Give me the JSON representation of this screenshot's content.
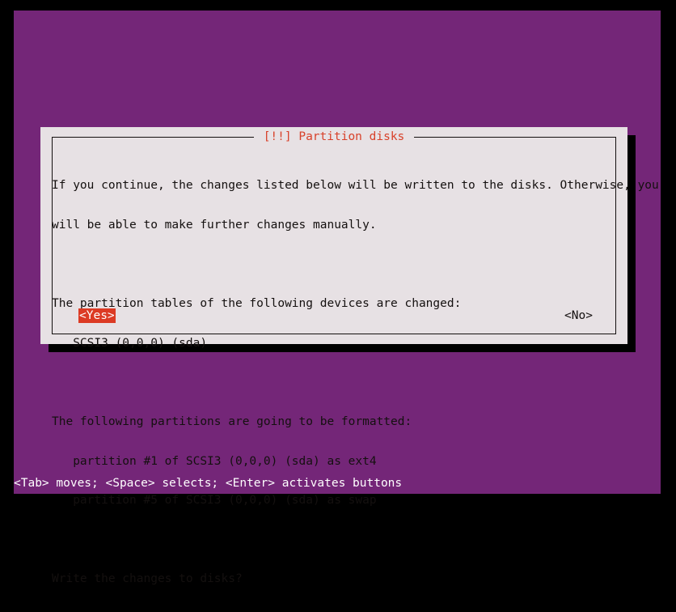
{
  "screen": {
    "background_color": "#000000",
    "console_color": "#742678"
  },
  "dialog": {
    "title": "[!!] Partition disks",
    "title_color": "#d8412a",
    "background_color": "#e7e1e4",
    "text_color": "#14100f",
    "body_lines": [
      "If you continue, the changes listed below will be written to the disks. Otherwise, you",
      "will be able to make further changes manually.",
      "",
      "The partition tables of the following devices are changed:",
      "   SCSI3 (0,0,0) (sda)",
      "",
      "The following partitions are going to be formatted:",
      "   partition #1 of SCSI3 (0,0,0) (sda) as ext4",
      "   partition #5 of SCSI3 (0,0,0) (sda) as swap",
      "",
      "Write the changes to disks?"
    ],
    "buttons": {
      "yes_label": "<Yes>",
      "no_label": "<No>",
      "selected": "yes",
      "selected_background": "#dc3a24",
      "selected_color": "#ffffff"
    }
  },
  "status_bar": {
    "text": "<Tab> moves; <Space> selects; <Enter> activates buttons",
    "background_color": "#742678",
    "text_color": "#ffffff"
  }
}
